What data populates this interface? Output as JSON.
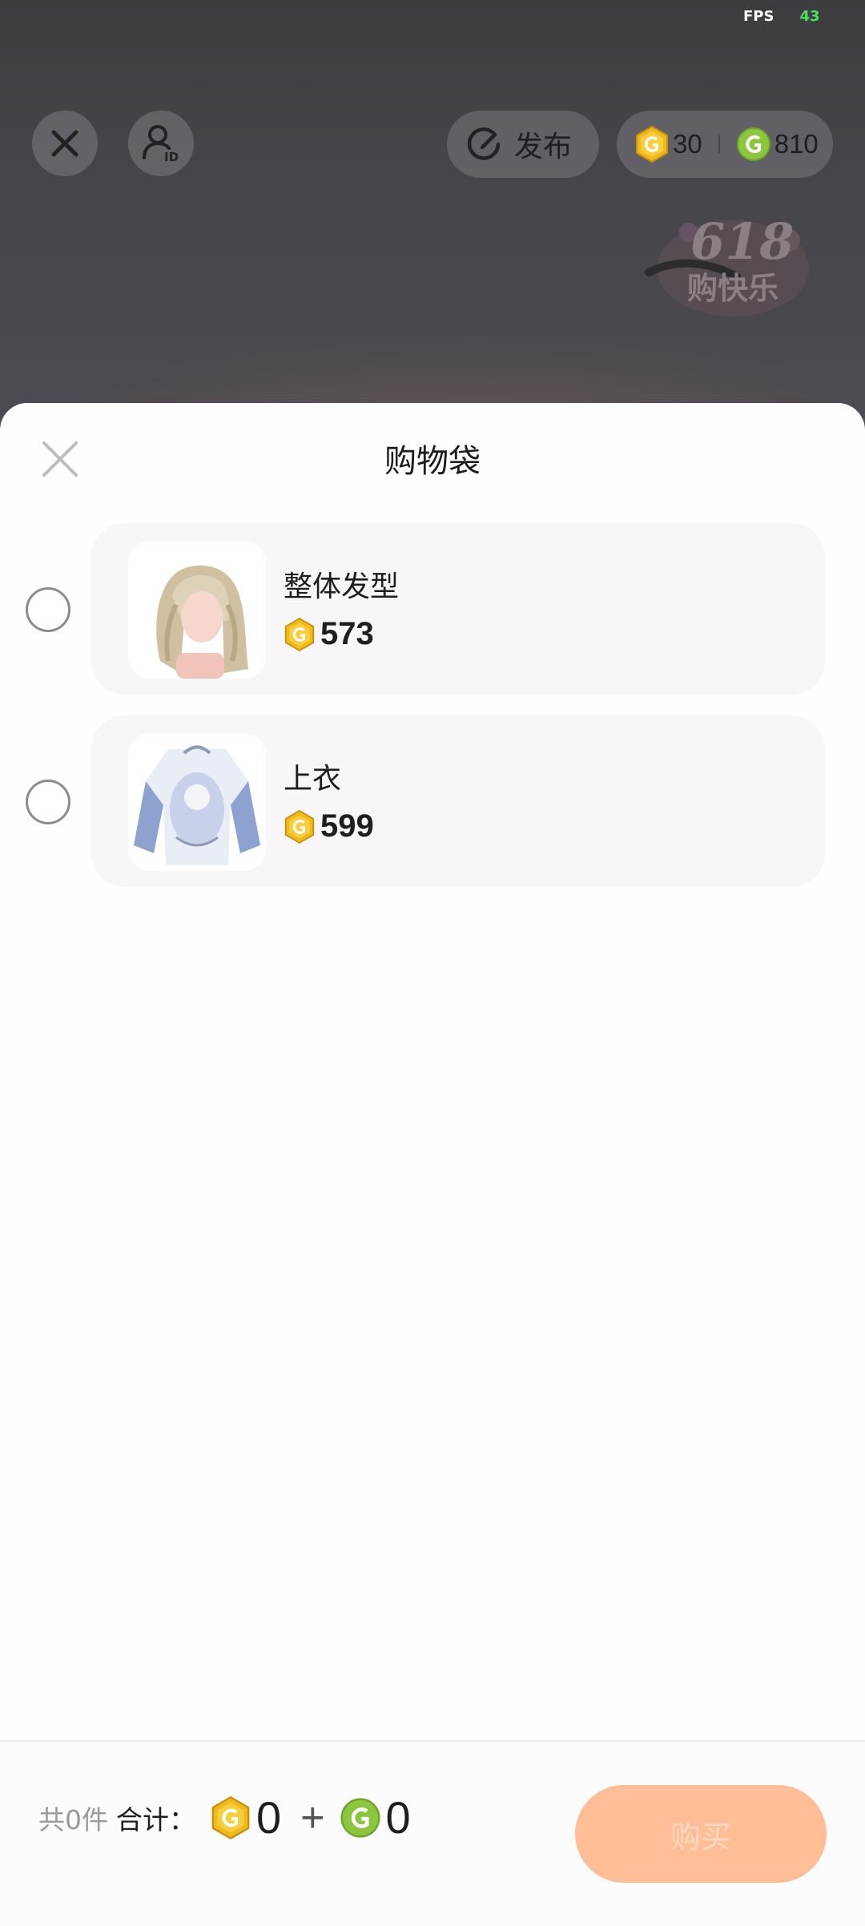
{
  "status": {
    "fps_label": "FPS",
    "fps_value": "43"
  },
  "top_bar": {
    "publish_label": "发布",
    "gold_coins": "30",
    "green_coins": "810"
  },
  "promo": {
    "badge_text": "618 购快乐"
  },
  "sheet": {
    "title": "购物袋",
    "items": [
      {
        "name": "整体发型",
        "price": "573",
        "currency": "gold-coin",
        "selected": false
      },
      {
        "name": "上衣",
        "price": "599",
        "currency": "gold-coin",
        "selected": false
      }
    ]
  },
  "footer": {
    "count_text": "共0件",
    "sum_label": "合计：",
    "gold_total": "0",
    "plus": "+",
    "green_total": "0",
    "buy_label": "购买"
  },
  "colors": {
    "gold_coin": "#f0b91c",
    "green_coin": "#8cc63f",
    "buy_button": "#ffbe96",
    "fps_value": "#46e05a"
  }
}
